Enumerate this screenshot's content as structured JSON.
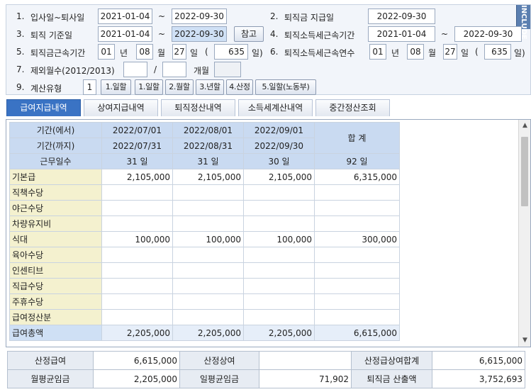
{
  "form": {
    "r1": {
      "n1": "1.",
      "l1": "입사일~퇴사일",
      "d1": "2021-01-04",
      "tilde": "~",
      "d2": "2022-09-30",
      "n2": "2.",
      "l2": "퇴직금 지급일",
      "d3": "2022-09-30"
    },
    "r2": {
      "n1": "3.",
      "l1": "퇴직 기준일",
      "d1": "2021-01-04",
      "tilde": "~",
      "d2": "2022-09-30",
      "ref": "참고",
      "n2": "4.",
      "l2": "퇴직소득세근속기간",
      "d3": "2021-01-04",
      "tilde2": "~",
      "d4": "2022-09-30"
    },
    "r3": {
      "n1": "5.",
      "l1": "퇴직금근속기간",
      "y": "01",
      "yu": "년",
      "m": "08",
      "mu": "월",
      "d": "27",
      "du": "일",
      "open": "(",
      "days": "635",
      "close": "일)",
      "n2": "6.",
      "l2": "퇴직소득세근속연수",
      "y2": "01",
      "m2": "08",
      "d2": "27",
      "days2": "635",
      "close2": "일)"
    },
    "r4": {
      "n1": "7.",
      "l1": "제외월수(2012/2013)",
      "v1": "",
      "slash": "/",
      "v2": "",
      "unit": "개월",
      "v3": ""
    },
    "r5": {
      "n1": "9.",
      "l1": "계산유형",
      "v": "1",
      "b1": "1.일할",
      "b2": "1.일할",
      "b3": "2.월할",
      "b4": "3.년할",
      "b5": "4.산정",
      "b6": "5.일할(노동부)"
    },
    "side_tab": "INCLUDE"
  },
  "tabs": [
    "급여지급내역",
    "상여지급내역",
    "퇴직정산내역",
    "소득세계산내역",
    "중간정산조회"
  ],
  "grid": {
    "h_from": "기간(에서)",
    "h_to": "기간(까지)",
    "h_days": "근무일수",
    "h_total": "합 계",
    "cols": [
      {
        "from": "2022/07/01",
        "to": "2022/07/31",
        "days": "31 일"
      },
      {
        "from": "2022/08/01",
        "to": "2022/08/31",
        "days": "31 일"
      },
      {
        "from": "2022/09/01",
        "to": "2022/09/30",
        "days": "30 일"
      }
    ],
    "total_days": "92 일",
    "rows": [
      {
        "label": "기본급",
        "v": [
          "2,105,000",
          "2,105,000",
          "2,105,000"
        ],
        "total": "6,315,000"
      },
      {
        "label": "직책수당",
        "v": [
          "",
          "",
          ""
        ],
        "total": ""
      },
      {
        "label": "야근수당",
        "v": [
          "",
          "",
          ""
        ],
        "total": ""
      },
      {
        "label": "차량유지비",
        "v": [
          "",
          "",
          ""
        ],
        "total": ""
      },
      {
        "label": "식대",
        "v": [
          "100,000",
          "100,000",
          "100,000"
        ],
        "total": "300,000"
      },
      {
        "label": "육아수당",
        "v": [
          "",
          "",
          ""
        ],
        "total": ""
      },
      {
        "label": "인센티브",
        "v": [
          "",
          "",
          ""
        ],
        "total": ""
      },
      {
        "label": "직급수당",
        "v": [
          "",
          "",
          ""
        ],
        "total": ""
      },
      {
        "label": "주휴수당",
        "v": [
          "",
          "",
          ""
        ],
        "total": ""
      },
      {
        "label": "급여정산분",
        "v": [
          "",
          "",
          ""
        ],
        "total": ""
      },
      {
        "label": "급여총액",
        "v": [
          "2,205,000",
          "2,205,000",
          "2,205,000"
        ],
        "total": "6,615,000"
      }
    ]
  },
  "summary": {
    "r1": {
      "l1": "산정급여",
      "v1": "6,615,000",
      "l2": "산정상여",
      "v2": "",
      "l3": "산정급상여합계",
      "v3": "6,615,000"
    },
    "r2": {
      "l1": "월평균임금",
      "v1": "2,205,000",
      "l2": "일평균임금",
      "v2": "71,902",
      "l3": "퇴직금 산출액",
      "v3": "3,752,693"
    }
  }
}
